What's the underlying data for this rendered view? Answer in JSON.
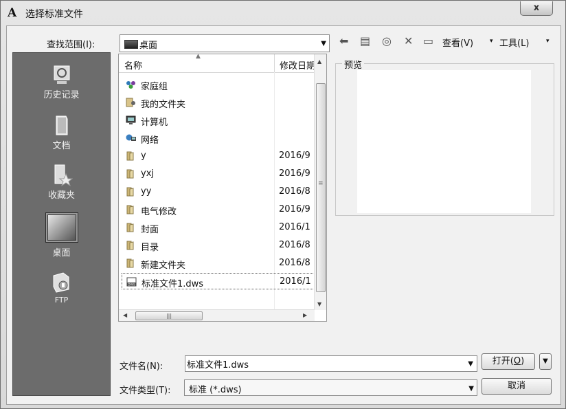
{
  "window": {
    "title": "选择标准文件",
    "app_icon": "A",
    "close_glyph": "x"
  },
  "lookin": {
    "label": "查找范围(I):",
    "value": "桌面"
  },
  "toolbar": {
    "view_label": "查看(V)",
    "tools_label": "工具(L)"
  },
  "places": [
    {
      "label": "历史记录",
      "icon": "history-icon"
    },
    {
      "label": "文档",
      "icon": "documents-icon"
    },
    {
      "label": "收藏夹",
      "icon": "favorites-icon"
    },
    {
      "label": "桌面",
      "icon": "desktop-icon",
      "selected": true
    },
    {
      "label": "FTP",
      "icon": "ftp-icon"
    }
  ],
  "file_list": {
    "columns": [
      "名称",
      "修改日期"
    ],
    "rows": [
      {
        "name": "家庭组",
        "date": "",
        "icon": "homegroup-icon"
      },
      {
        "name": "我的文件夹",
        "date": "",
        "icon": "user-folder-icon"
      },
      {
        "name": "计算机",
        "date": "",
        "icon": "computer-icon"
      },
      {
        "name": "网络",
        "date": "",
        "icon": "network-icon"
      },
      {
        "name": "y",
        "date": "2016/9",
        "icon": "folder-icon"
      },
      {
        "name": "yxj",
        "date": "2016/9",
        "icon": "folder-icon"
      },
      {
        "name": "yy",
        "date": "2016/8",
        "icon": "folder-icon"
      },
      {
        "name": "电气修改",
        "date": "2016/9",
        "icon": "folder-icon"
      },
      {
        "name": "封面",
        "date": "2016/1",
        "icon": "folder-icon"
      },
      {
        "name": "目录",
        "date": "2016/8",
        "icon": "folder-icon"
      },
      {
        "name": "新建文件夹",
        "date": "2016/8",
        "icon": "folder-icon"
      },
      {
        "name": "标准文件1.dws",
        "date": "2016/1",
        "icon": "dws-file-icon",
        "selected": true
      }
    ]
  },
  "preview": {
    "label": "预览"
  },
  "filename": {
    "label": "文件名(N):",
    "value": "标准文件1.dws"
  },
  "filetype": {
    "label": "文件类型(T):",
    "value": "标准 (*.dws)"
  },
  "buttons": {
    "open_prefix": "打开(",
    "open_key": "O",
    "open_suffix": ")",
    "cancel": "取消"
  }
}
